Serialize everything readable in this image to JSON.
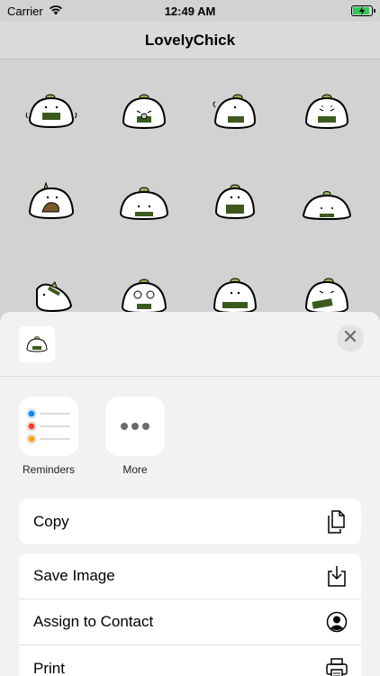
{
  "status_bar": {
    "carrier": "Carrier",
    "time": "12:49 AM"
  },
  "nav": {
    "title": "LovelyChick"
  },
  "sheet": {
    "apps": [
      {
        "label": "Reminders",
        "icon": "reminders-icon"
      },
      {
        "label": "More",
        "icon": "more-icon"
      }
    ],
    "actions": [
      {
        "label": "Copy",
        "icon": "copy-icon"
      },
      {
        "label": "Save Image",
        "icon": "save-image-icon"
      },
      {
        "label": "Assign to Contact",
        "icon": "contact-icon"
      },
      {
        "label": "Print",
        "icon": "print-icon"
      }
    ]
  },
  "colors": {
    "accent_green": "#34c759",
    "chick_band": "#3d5a1e",
    "chick_leaf": "#8db34a",
    "reminders_blue": "#0a84ff",
    "reminders_red": "#ff3b30",
    "reminders_orange": "#ff9f0a"
  }
}
